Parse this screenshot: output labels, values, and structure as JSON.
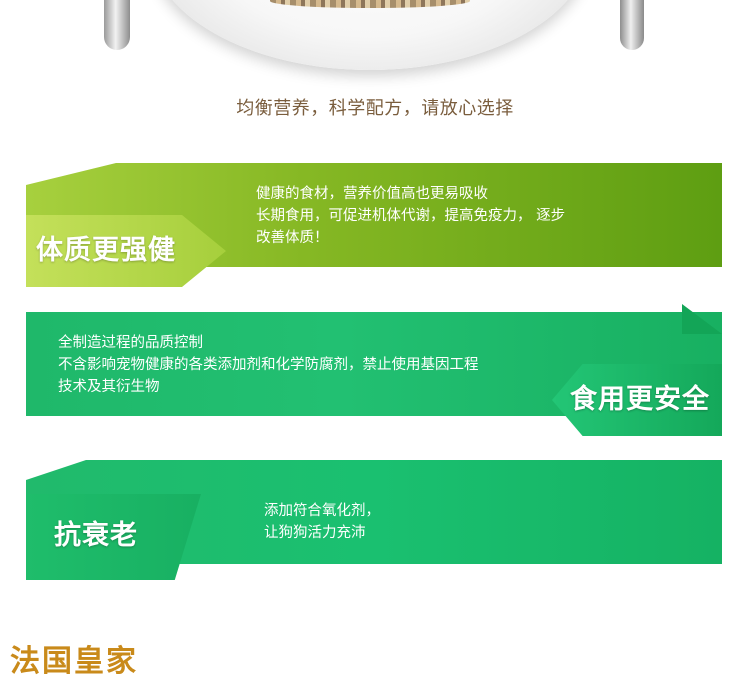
{
  "header": {
    "tagline": "均衡营养，科学配方，请放心选择"
  },
  "bands": [
    {
      "title": "体质更强健",
      "lines": [
        "健康的食材，营养价值高也更易吸收",
        "长期食用，可促进机体代谢，提高免疫力， 逐步",
        "改善体质！"
      ]
    },
    {
      "title": "食用更安全",
      "lines": [
        "全制造过程的品质控制",
        "不含影响宠物健康的各类添加剂和化学防腐剂，禁止使用基因工程",
        "技术及其衍生物"
      ]
    },
    {
      "title": "抗衰老",
      "lines": [
        "添加符合氧化剂，",
        "让狗狗活力充沛"
      ]
    }
  ],
  "footer": {
    "partial_title": "法国皇家"
  },
  "colors": {
    "band1_green": "#86b824",
    "band2_green": "#22c072",
    "band3_green": "#1ac070",
    "tagline_brown": "#7a5d3d"
  }
}
